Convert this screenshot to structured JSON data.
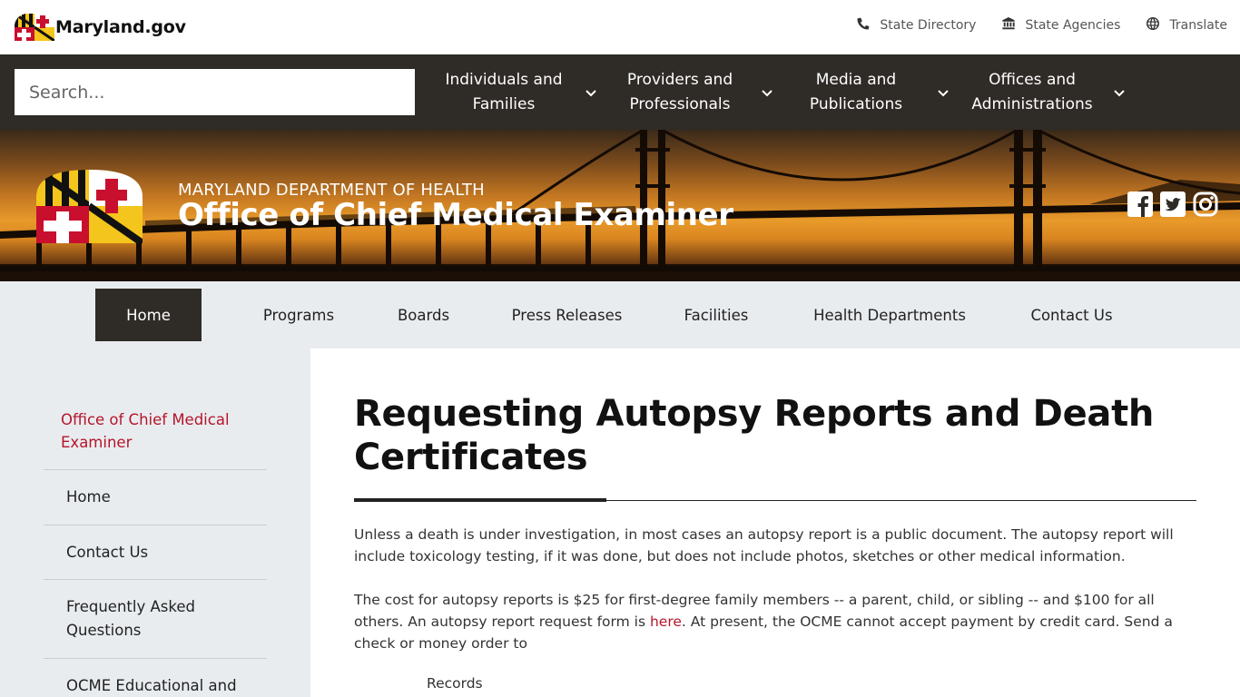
{
  "topbar": {
    "logo_text": "Maryland.gov",
    "links": [
      {
        "label": "State Directory",
        "icon": "phone-icon"
      },
      {
        "label": "State Agencies",
        "icon": "building-icon"
      },
      {
        "label": "Translate",
        "icon": "globe-icon"
      }
    ]
  },
  "navbar": {
    "search_placeholder": "Search...",
    "items": [
      {
        "label": "Individuals and Families"
      },
      {
        "label": "Providers and Professionals"
      },
      {
        "label": "Media and Publications"
      },
      {
        "label": "Offices and Administrations"
      }
    ]
  },
  "banner": {
    "department": "MARYLAND DEPARTMENT OF HEALTH",
    "office": "Office of Chief Medical Examiner",
    "social": [
      "facebook-icon",
      "twitter-icon",
      "instagram-icon"
    ]
  },
  "secnav": {
    "items": [
      "Home",
      "Programs",
      "Boards",
      "Press Releases",
      "Facilities",
      "Health Departments",
      "Contact Us"
    ],
    "active": "Home"
  },
  "sidebar": {
    "heading": "Office of Chief Medical Examiner",
    "items": [
      "Home",
      "Contact Us",
      "Frequently Asked Questions",
      "OCME Educational and"
    ]
  },
  "main": {
    "title": "Requesting Autopsy Reports and Death Certificates",
    "para1": "Unless a death is under investigation, in most cases an autopsy report is a public document. The autopsy report will include toxicology testing, if it was done, but does not include photos, sketches or other medical information.",
    "para2_before": "The cost for autopsy reports is $25 for first-degree family members -- a parent, child, or sibling -- and $100 for all others. An autopsy report request form is ",
    "para2_link": "here",
    "para2_after": ". At present, the OCME cannot accept payment by credit card. Send a check or money order to",
    "address_line": "Records"
  },
  "colors": {
    "accent_red": "#b5152b",
    "nav_dark": "#2f2b27",
    "light_gray": "#e9ecef"
  }
}
